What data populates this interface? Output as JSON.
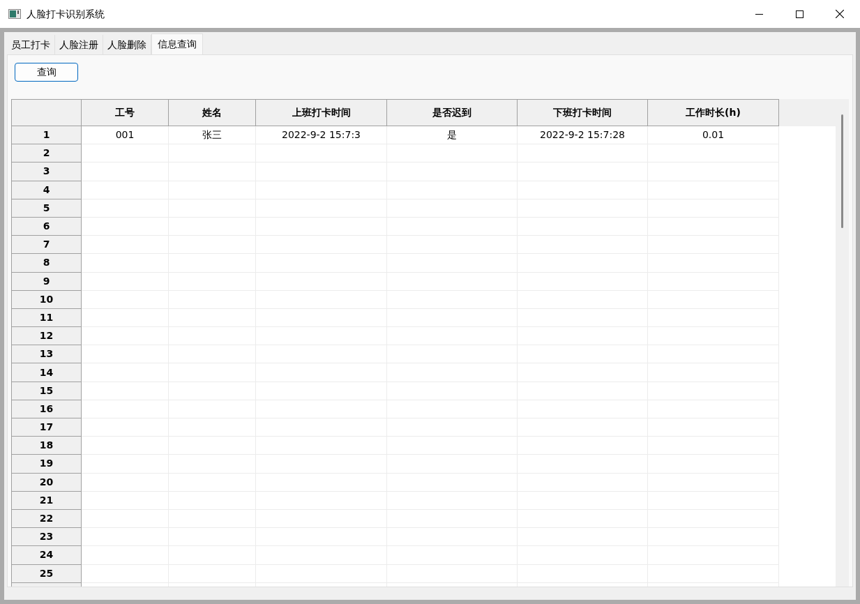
{
  "window": {
    "title": "人脸打卡识别系统"
  },
  "tabs": [
    {
      "label": "员工打卡",
      "selected": false
    },
    {
      "label": "人脸注册",
      "selected": false
    },
    {
      "label": "人脸删除",
      "selected": false
    },
    {
      "label": "信息查询",
      "selected": true
    }
  ],
  "query_button": "查询",
  "table": {
    "columns": [
      "工号",
      "姓名",
      "上班打卡时间",
      "是否迟到",
      "下班打卡时间",
      "工作时长(h)"
    ],
    "rows": [
      {
        "number": "1",
        "cells": [
          "001",
          "张三",
          "2022-9-2 15:7:3",
          "是",
          "2022-9-2 15:7:28",
          "0.01"
        ]
      },
      {
        "number": "2"
      },
      {
        "number": "3"
      },
      {
        "number": "4"
      },
      {
        "number": "5"
      },
      {
        "number": "6"
      },
      {
        "number": "7"
      },
      {
        "number": "8"
      },
      {
        "number": "9"
      },
      {
        "number": "10"
      },
      {
        "number": "11"
      },
      {
        "number": "12"
      },
      {
        "number": "13"
      },
      {
        "number": "14"
      },
      {
        "number": "15"
      },
      {
        "number": "16"
      },
      {
        "number": "17"
      },
      {
        "number": "18"
      },
      {
        "number": "19"
      },
      {
        "number": "20"
      },
      {
        "number": "21"
      },
      {
        "number": "22"
      },
      {
        "number": "23"
      },
      {
        "number": "24"
      },
      {
        "number": "25"
      }
    ]
  }
}
